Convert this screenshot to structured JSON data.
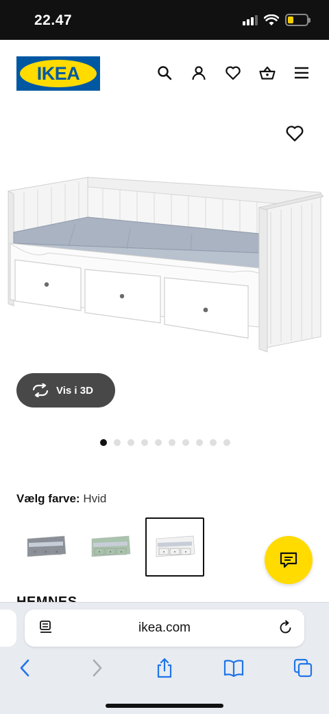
{
  "status": {
    "time": "22.47"
  },
  "logo": {
    "text": "IKEA"
  },
  "header": {
    "icons": [
      "search-icon",
      "account-icon",
      "heart-icon",
      "basket-icon",
      "menu-icon"
    ]
  },
  "product": {
    "view_3d_label": "Vis i 3D",
    "gallery_dots": 10,
    "gallery_active_index": 0,
    "color_label": "Vælg farve:",
    "color_value": "Hvid",
    "swatches": [
      {
        "color": "#8a8f97",
        "selected": false
      },
      {
        "color": "#a9c3ac",
        "selected": false
      },
      {
        "color": "#f2f2f2",
        "selected": true
      }
    ],
    "name": "HEMNES"
  },
  "colors": {
    "brand_blue": "#0058a3",
    "brand_yellow": "#ffdb00"
  },
  "browser": {
    "url": "ikea.com"
  }
}
